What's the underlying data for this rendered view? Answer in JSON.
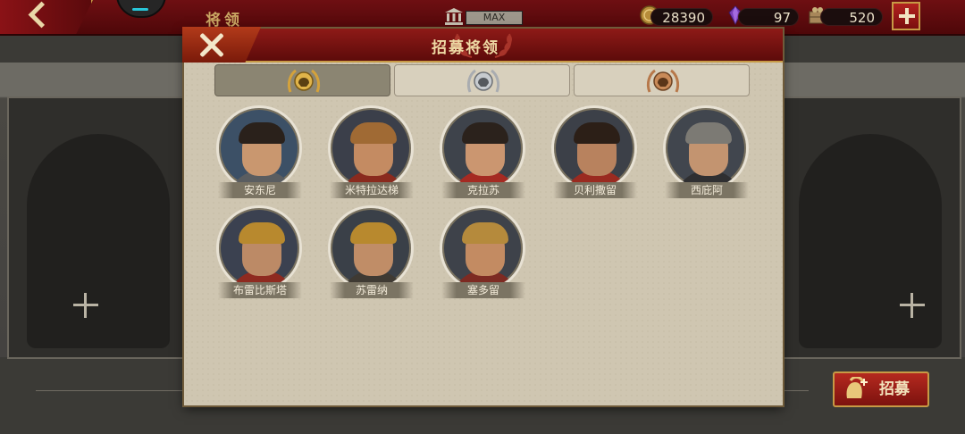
{
  "topbar": {
    "page_title": "将领",
    "building_level": "MAX",
    "resources": [
      {
        "icon": "gold-coin-icon",
        "value": "28390"
      },
      {
        "icon": "purple-gem-icon",
        "value": "97"
      },
      {
        "icon": "food-crate-icon",
        "value": "520"
      }
    ]
  },
  "modal": {
    "title": "招募将领",
    "tabs": [
      {
        "name": "gold",
        "emblem": "gold-helmet-laurel-icon",
        "active": true
      },
      {
        "name": "silver",
        "emblem": "silver-helmet-laurel-icon",
        "active": false
      },
      {
        "name": "bronze",
        "emblem": "bronze-helmet-laurel-icon",
        "active": false
      }
    ],
    "generals": [
      {
        "name": "安东尼"
      },
      {
        "name": "米特拉达梯"
      },
      {
        "name": "克拉苏"
      },
      {
        "name": "贝利撒留"
      },
      {
        "name": "西庇阿"
      },
      {
        "name": "布雷比斯塔"
      },
      {
        "name": "苏雷纳"
      },
      {
        "name": "塞多留"
      }
    ]
  },
  "recruit_button": {
    "label": "招募"
  },
  "colors": {
    "header_red": "#6e0f12",
    "gold_trim": "#c79a45",
    "parchment": "#cfc6b1"
  }
}
